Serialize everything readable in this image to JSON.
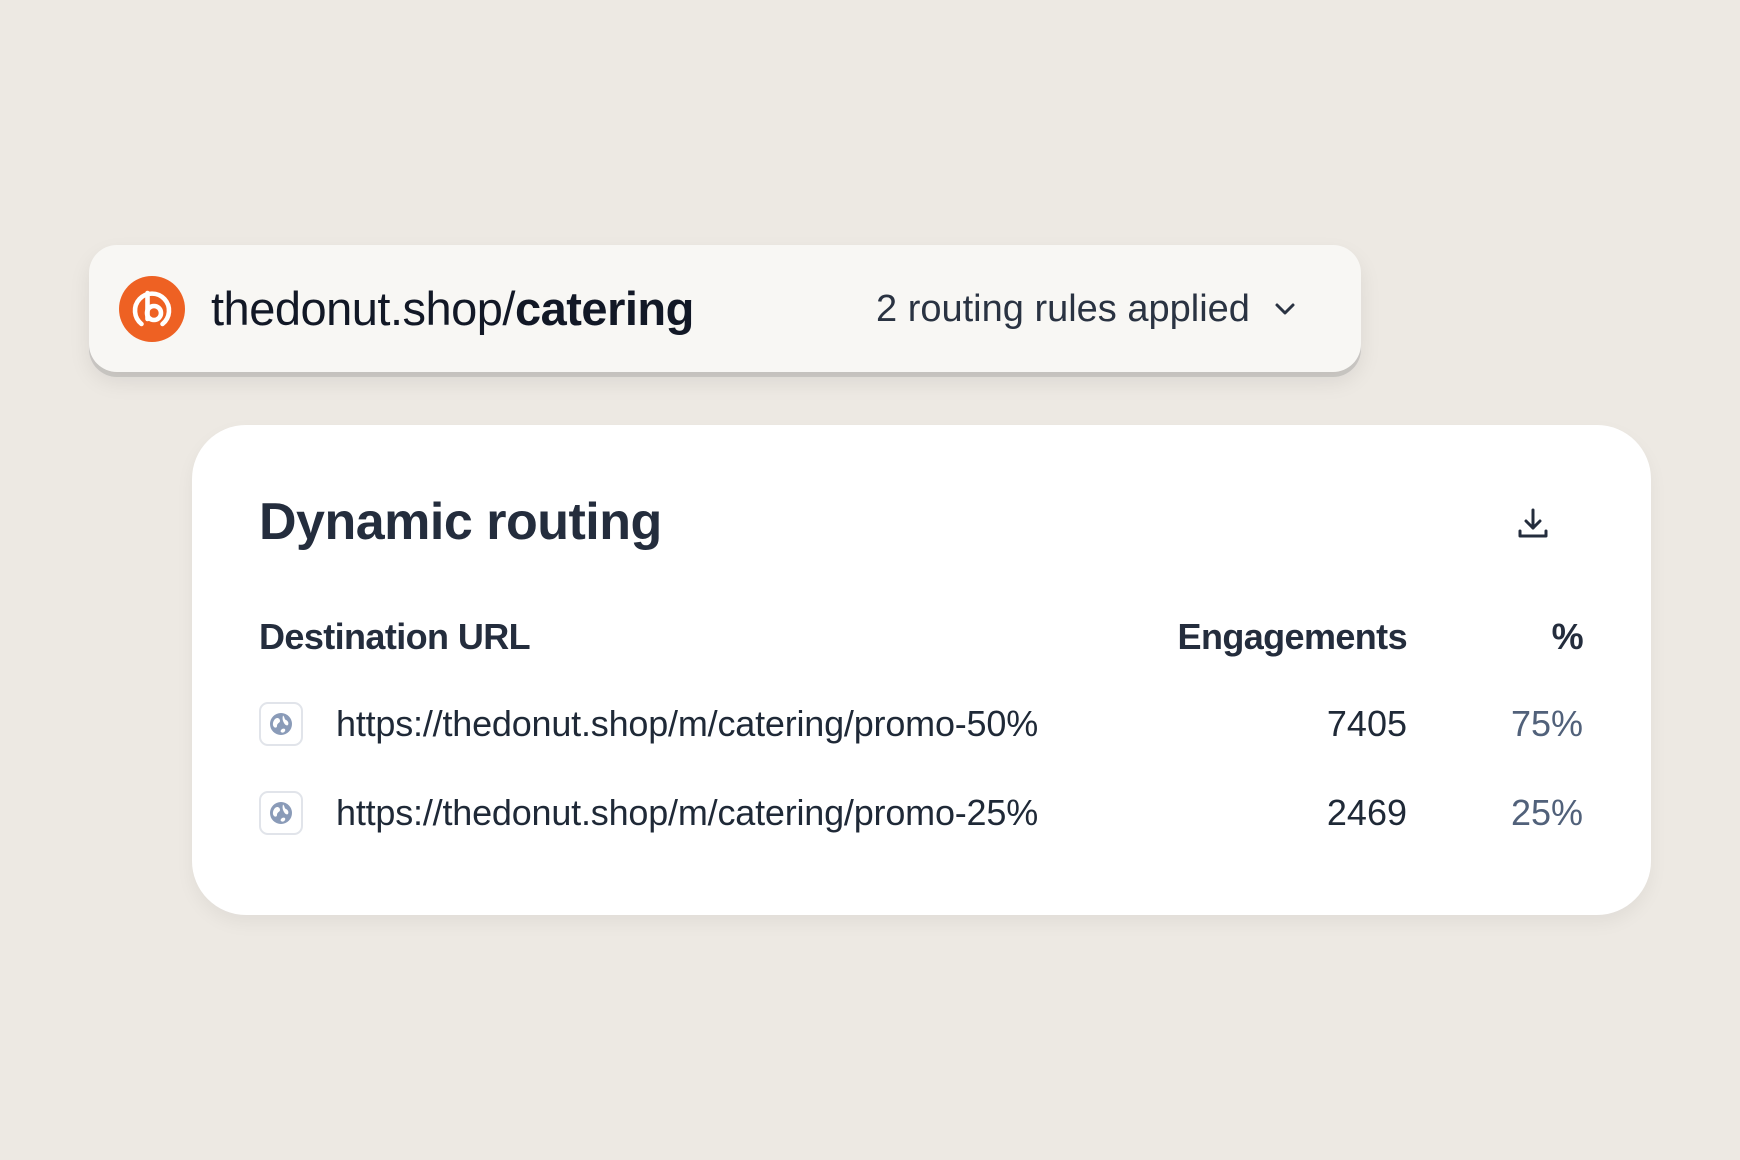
{
  "link_bar": {
    "domain": "thedonut.shop/",
    "slug": "catering",
    "rules_label": "2 routing rules applied",
    "logo_icon": "bitly-logo-icon",
    "toggle_icon": "chevron-down-icon"
  },
  "routing": {
    "title": "Dynamic routing",
    "download_icon": "download-icon",
    "columns": {
      "destination": "Destination URL",
      "engagements": "Engagements",
      "percent": "%"
    },
    "rows": [
      {
        "icon": "globe-icon",
        "url": "https://thedonut.shop/m/catering/promo-50%",
        "engagements": "7405",
        "percent": "75%"
      },
      {
        "icon": "globe-icon",
        "url": "https://thedonut.shop/m/catering/promo-25%",
        "engagements": "2469",
        "percent": "25%"
      }
    ]
  },
  "colors": {
    "background": "#ede9e3",
    "brand_orange": "#ee6123",
    "card": "#ffffff",
    "text_dark": "#242d3d",
    "percent_text": "#51617a"
  }
}
